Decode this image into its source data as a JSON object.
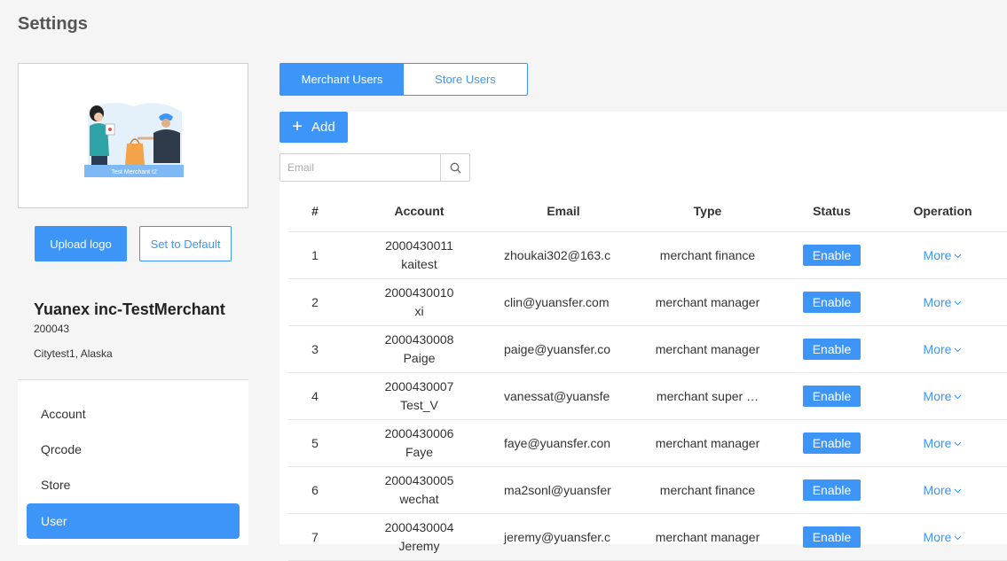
{
  "page": {
    "title": "Settings"
  },
  "logo_card": {
    "logo_caption": "Test Merchant t2"
  },
  "left_panel": {
    "upload_logo_label": "Upload logo",
    "set_default_label": "Set to Default",
    "merchant_name": "Yuanex inc-TestMerchant",
    "merchant_id": "200043",
    "merchant_location": "Citytest1, Alaska",
    "nav": [
      {
        "label": "Account",
        "active": false
      },
      {
        "label": "Qrcode",
        "active": false
      },
      {
        "label": "Store",
        "active": false
      },
      {
        "label": "User",
        "active": true
      }
    ]
  },
  "tabs": [
    {
      "label": "Merchant Users",
      "active": true
    },
    {
      "label": "Store Users",
      "active": false
    }
  ],
  "toolbar": {
    "add_label": "Add",
    "add_icon": "plus-icon"
  },
  "search": {
    "placeholder": "Email",
    "value": "",
    "icon": "search-icon"
  },
  "table": {
    "columns": [
      "#",
      "Account",
      "Email",
      "Type",
      "Status",
      "Operation"
    ],
    "rows": [
      {
        "index": "1",
        "account_id": "2000430011",
        "account_name": "kaitest",
        "email": "zhoukai302@163.c",
        "type": "merchant finance",
        "status": "Enable",
        "operation": "More"
      },
      {
        "index": "2",
        "account_id": "2000430010",
        "account_name": "xi",
        "email": "clin@yuansfer.com",
        "type": "merchant manager",
        "status": "Enable",
        "operation": "More"
      },
      {
        "index": "3",
        "account_id": "2000430008",
        "account_name": "Paige",
        "email": "paige@yuansfer.co",
        "type": "merchant manager",
        "status": "Enable",
        "operation": "More"
      },
      {
        "index": "4",
        "account_id": "2000430007",
        "account_name": "Test_V",
        "email": "vanessat@yuansfe",
        "type": "merchant super …",
        "status": "Enable",
        "operation": "More"
      },
      {
        "index": "5",
        "account_id": "2000430006",
        "account_name": "Faye",
        "email": "faye@yuansfer.con",
        "type": "merchant manager",
        "status": "Enable",
        "operation": "More"
      },
      {
        "index": "6",
        "account_id": "2000430005",
        "account_name": "wechat",
        "email": "ma2sonl@yuansfer",
        "type": "merchant finance",
        "status": "Enable",
        "operation": "More"
      },
      {
        "index": "7",
        "account_id": "2000430004",
        "account_name": "Jeremy",
        "email": "jeremy@yuansfer.c",
        "type": "merchant manager",
        "status": "Enable",
        "operation": "More"
      }
    ]
  },
  "colors": {
    "accent": "#3d96f7",
    "background": "#f5f5f5"
  }
}
